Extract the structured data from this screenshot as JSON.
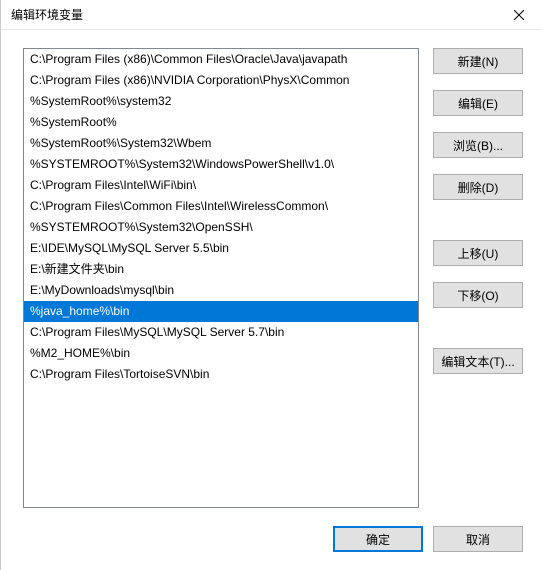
{
  "title": "编辑环境变量",
  "list_items": [
    "C:\\Program Files (x86)\\Common Files\\Oracle\\Java\\javapath",
    "C:\\Program Files (x86)\\NVIDIA Corporation\\PhysX\\Common",
    "%SystemRoot%\\system32",
    "%SystemRoot%",
    "%SystemRoot%\\System32\\Wbem",
    "%SYSTEMROOT%\\System32\\WindowsPowerShell\\v1.0\\",
    "C:\\Program Files\\Intel\\WiFi\\bin\\",
    "C:\\Program Files\\Common Files\\Intel\\WirelessCommon\\",
    "%SYSTEMROOT%\\System32\\OpenSSH\\",
    "E:\\IDE\\MySQL\\MySQL Server 5.5\\bin",
    "E:\\新建文件夹\\bin",
    "E:\\MyDownloads\\mysql\\bin",
    "%java_home%\\bin",
    "C:\\Program Files\\MySQL\\MySQL Server 5.7\\bin",
    "%M2_HOME%\\bin",
    "C:\\Program Files\\TortoiseSVN\\bin"
  ],
  "selected_index": 12,
  "buttons": {
    "new": "新建(N)",
    "edit": "编辑(E)",
    "browse": "浏览(B)...",
    "delete": "删除(D)",
    "move_up": "上移(U)",
    "move_down": "下移(O)",
    "edit_text": "编辑文本(T)...",
    "ok": "确定",
    "cancel": "取消"
  }
}
